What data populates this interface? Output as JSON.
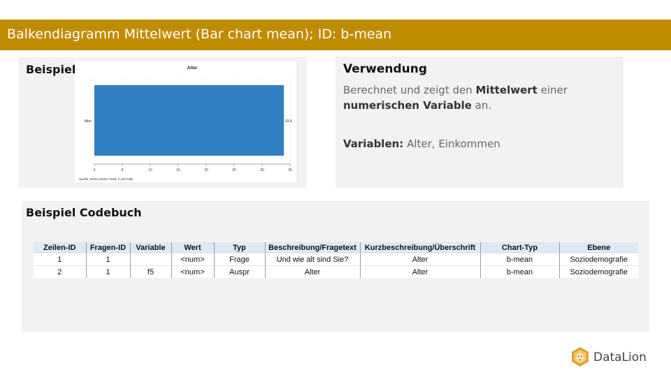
{
  "title": "Balkendiagramm Mittelwert (Bar chart mean); ID: b-mean",
  "example": {
    "label": "Beispiel",
    "chart": {
      "title": "Alter",
      "category": "Alter",
      "value_label": "33,9",
      "source": "Quelle: Demo-Daten 2018, n=82 Fälle"
    }
  },
  "usage": {
    "label": "Verwendung",
    "desc_part1": "Berechnet  und zeigt den ",
    "desc_bold1": "Mittelwert",
    "desc_part2": " einer",
    "desc_bold2": "numerischen Variable",
    "desc_part3": " an.",
    "variables_label": "Variablen:",
    "variables_value": " Alter, Einkommen"
  },
  "codebook": {
    "label": "Beispiel Codebuch",
    "headers": [
      "Zeilen-ID",
      "Fragen-ID",
      "Variable",
      "Wert",
      "Typ",
      "Beschreibung/Fragetext",
      "Kurzbeschreibung/Überschrift",
      "Chart-Typ",
      "Ebene"
    ],
    "rows": [
      [
        "1",
        "1",
        "",
        "<num>",
        "Frage",
        "Und wie alt sind Sie?",
        "Alter",
        "b-mean",
        "Soziodemografie"
      ],
      [
        "2",
        "1",
        "f5",
        "<num>",
        "Auspr",
        "Alter",
        "Alter",
        "b-mean",
        "Soziodemografie"
      ]
    ]
  },
  "logo": {
    "text": "DataLion",
    "icon": "lion-icon"
  },
  "colors": {
    "title_bar": "#bf8c00",
    "bar": "#2f7fc1",
    "panel": "#f2f2f2",
    "table_header": "#dde9f6"
  },
  "chart_data": {
    "type": "bar",
    "orientation": "horizontal",
    "title": "Alter",
    "categories": [
      "Alter"
    ],
    "values": [
      33.9
    ],
    "xlim": [
      0,
      35
    ],
    "xticks": [
      0,
      5,
      10,
      15,
      20,
      25,
      30,
      35
    ],
    "xlabel": "",
    "ylabel": "",
    "grid": true,
    "legend": "none"
  }
}
